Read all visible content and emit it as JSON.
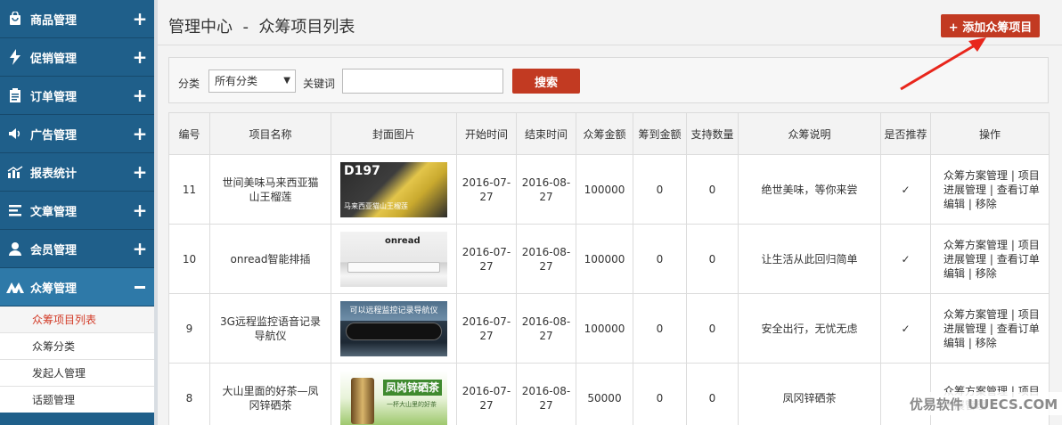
{
  "sidebar": {
    "items": [
      {
        "label": "商品管理",
        "icon": "bag-icon"
      },
      {
        "label": "促销管理",
        "icon": "lightning-icon"
      },
      {
        "label": "订单管理",
        "icon": "clipboard-icon"
      },
      {
        "label": "广告管理",
        "icon": "megaphone-icon"
      },
      {
        "label": "报表统计",
        "icon": "chart-icon"
      },
      {
        "label": "文章管理",
        "icon": "list-icon"
      },
      {
        "label": "会员管理",
        "icon": "user-icon"
      },
      {
        "label": "众筹管理",
        "icon": "crowd-icon"
      }
    ],
    "expand_symbol": "+",
    "sub_items": [
      "众筹项目列表",
      "众筹分类",
      "发起人管理",
      "话题管理"
    ]
  },
  "header": {
    "title": "管理中心  -  众筹项目列表",
    "add_button": "+ 添加众筹项目"
  },
  "search": {
    "category_label": "分类",
    "category_value": "所有分类",
    "category_arrow": "▼",
    "keyword_label": "关键词",
    "keyword_value": "",
    "search_button": "搜索"
  },
  "table": {
    "headers": [
      "编号",
      "项目名称",
      "封面图片",
      "开始时间",
      "结束时间",
      "众筹金额",
      "筹到金额",
      "支持数量",
      "众筹说明",
      "是否推荐",
      "操作"
    ],
    "rows": [
      {
        "id": "11",
        "name": "世间美味马来西亚猫山王榴莲",
        "thumb_text": "D197",
        "thumb_sub": "马来西亚猫山王榴莲",
        "start": "2016-07-27",
        "end": "2016-08-27",
        "goal": "100000",
        "raised": "0",
        "supporters": "0",
        "desc": "绝世美味，等你来尝",
        "recommend": "✓"
      },
      {
        "id": "10",
        "name": "onread智能排插",
        "thumb_text": "onread",
        "thumb_sub": "",
        "start": "2016-07-27",
        "end": "2016-08-27",
        "goal": "100000",
        "raised": "0",
        "supporters": "0",
        "desc": "让生活从此回归简单",
        "recommend": "✓"
      },
      {
        "id": "9",
        "name": "3G远程监控语音记录导航仪",
        "thumb_text": "可以远程监控记录导航仪",
        "thumb_sub": "",
        "start": "2016-07-27",
        "end": "2016-08-27",
        "goal": "100000",
        "raised": "0",
        "supporters": "0",
        "desc": "安全出行，无忧无虑",
        "recommend": "✓"
      },
      {
        "id": "8",
        "name": "大山里面的好茶—凤冈锌硒茶",
        "thumb_text": "凤岗锌硒茶",
        "thumb_sub": "一杯大山里的好茶",
        "start": "2016-07-27",
        "end": "2016-08-27",
        "goal": "50000",
        "raised": "0",
        "supporters": "0",
        "desc": "凤冈锌硒茶",
        "recommend": ""
      }
    ],
    "ops": {
      "plan": "众筹方案管理",
      "progress": "项目进展管理",
      "orders": "查看订单",
      "edit": "编辑",
      "remove": "移除",
      "sep": "|"
    }
  },
  "watermark": "优易软件 UUECS.COM",
  "colors": {
    "sidebar": "#1f5f8a",
    "sidebar_active": "#2e79a8",
    "accent_red": "#c23a22",
    "link_blue": "#2b7bbd",
    "check_green": "#2aa04a"
  }
}
